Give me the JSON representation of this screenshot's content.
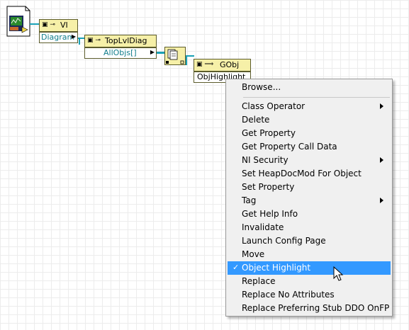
{
  "nodes": {
    "vi": {
      "title": "VI",
      "property": "Diagram"
    },
    "toplvl": {
      "title": "TopLvlDiag",
      "property": "AllObjs[]"
    },
    "gobj": {
      "title": "GObj",
      "property": "ObjHighlight"
    }
  },
  "context_menu": {
    "browse": "Browse...",
    "items": [
      {
        "label": "Class Operator",
        "submenu": true
      },
      {
        "label": "Delete",
        "submenu": false
      },
      {
        "label": "Get Property",
        "submenu": false
      },
      {
        "label": "Get Property Call Data",
        "submenu": false
      },
      {
        "label": "NI Security",
        "submenu": true
      },
      {
        "label": "Set HeapDocMod For Object",
        "submenu": false
      },
      {
        "label": "Set Property",
        "submenu": false
      },
      {
        "label": "Tag",
        "submenu": true
      },
      {
        "label": "Get Help Info",
        "submenu": false
      },
      {
        "label": "Invalidate",
        "submenu": false
      },
      {
        "label": "Launch Config Page",
        "submenu": false
      },
      {
        "label": "Move",
        "submenu": false
      },
      {
        "label": "Object Highlight",
        "submenu": false,
        "checked": true,
        "highlighted": true
      },
      {
        "label": "Replace",
        "submenu": false
      },
      {
        "label": "Replace No Attributes",
        "submenu": false
      },
      {
        "label": "Replace Preferring Stub DDO OnFP",
        "submenu": false
      }
    ],
    "check_mark": "✓"
  },
  "colors": {
    "node_header": "#f6f0a8",
    "property_text": "#0f7c8a",
    "wire": "#1aa0b5",
    "menu_highlight": "#3399ff"
  }
}
